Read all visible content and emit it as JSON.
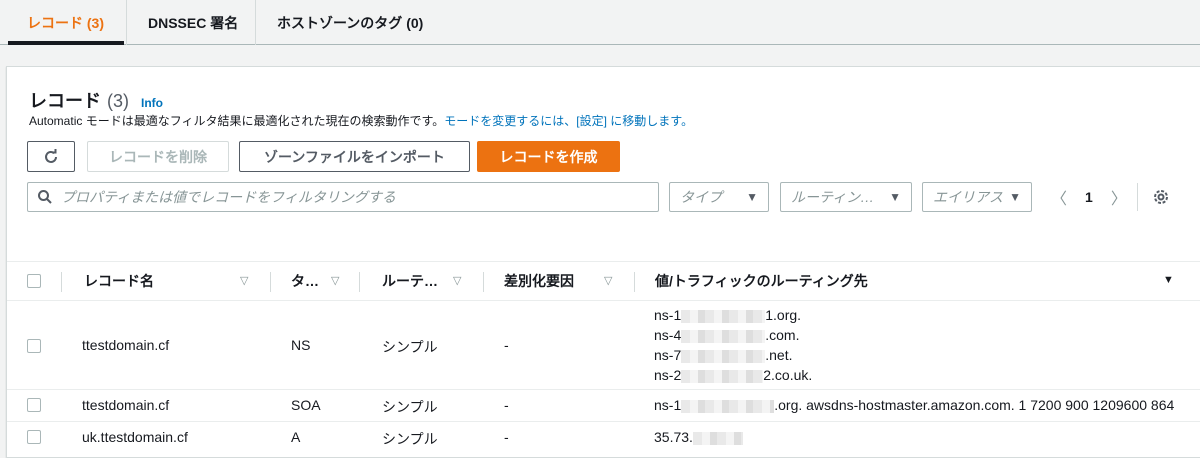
{
  "tabs": [
    {
      "label": "レコード (3)",
      "active": true
    },
    {
      "label": "DNSSEC 署名",
      "active": false
    },
    {
      "label": "ホストゾーンのタグ (0)",
      "active": false
    }
  ],
  "header": {
    "title": "レコード",
    "count": "(3)",
    "info": "Info",
    "description": "Automatic モードは最適なフィルタ結果に最適化された現在の検索動作です。",
    "description_link": "モードを変更するには、[設定] に移動します。"
  },
  "toolbar": {
    "refresh_icon": "refresh-icon",
    "delete_label": "レコードを削除",
    "import_label": "ゾーンファイルをインポート",
    "create_label": "レコードを作成"
  },
  "filters": {
    "search_placeholder": "プロパティまたは値でレコードをフィルタリングする",
    "type_placeholder": "タイプ",
    "routing_placeholder": "ルーティン…",
    "alias_placeholder": "エイリアス",
    "page": "1"
  },
  "table": {
    "columns": [
      "レコード名",
      "タ…",
      "ルーテ…",
      "差別化要因",
      "値/トラフィックのルーティング先"
    ],
    "rows": [
      {
        "name": "ttestdomain.cf",
        "type": "NS",
        "routing": "シンプル",
        "diff": "-",
        "values": [
          {
            "prefix": "ns-1",
            "suffix": "1.org."
          },
          {
            "prefix": "ns-4",
            "suffix": ".com."
          },
          {
            "prefix": "ns-7",
            "suffix": ".net."
          },
          {
            "prefix": "ns-2",
            "suffix": "2.co.uk."
          }
        ]
      },
      {
        "name": "ttestdomain.cf",
        "type": "SOA",
        "routing": "シンプル",
        "diff": "-",
        "values": [
          {
            "prefix": "ns-1",
            "suffix": ".org. awsdns-hostmaster.amazon.com. 1 7200 900 1209600 864"
          }
        ]
      },
      {
        "name": "uk.ttestdomain.cf",
        "type": "A",
        "routing": "シンプル",
        "diff": "-",
        "values": [
          {
            "prefix": "35.73.",
            "suffix": ""
          }
        ]
      }
    ]
  },
  "colors": {
    "accent": "#ec7211",
    "link": "#0073bb"
  }
}
